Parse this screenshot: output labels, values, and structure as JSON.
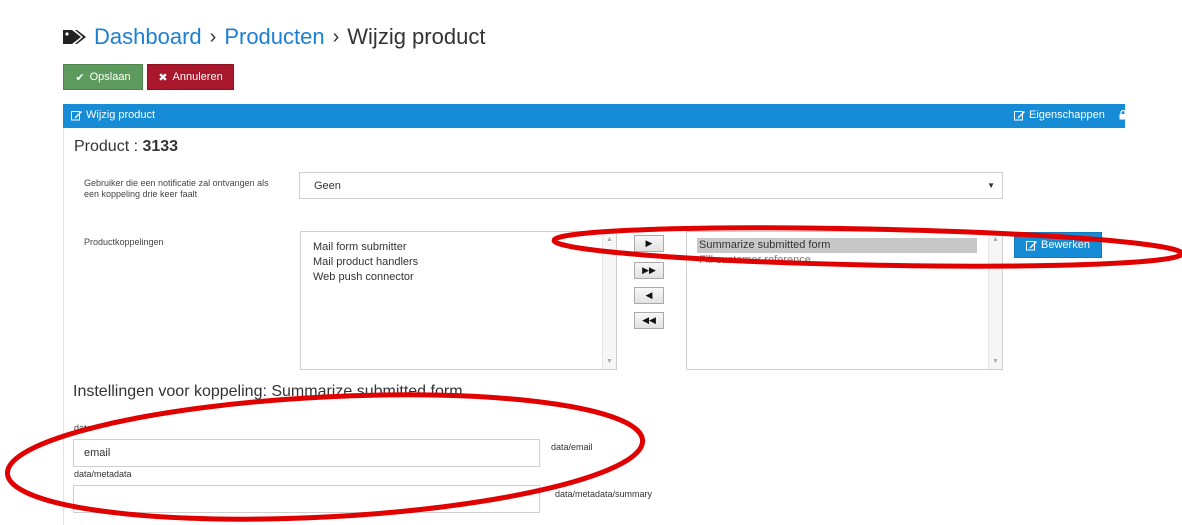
{
  "breadcrumb": {
    "items": [
      "Dashboard",
      "Producten"
    ],
    "separator": "›",
    "current": "Wijzig product"
  },
  "toolbar": {
    "save_label": "Opslaan",
    "cancel_label": "Annuleren"
  },
  "panel": {
    "title": "Wijzig product",
    "properties_label": "Eigenschappen"
  },
  "product": {
    "label": "Product :",
    "number": "3133"
  },
  "form": {
    "notify_label": "Gebruiker die een notificatie zal ontvangen als een koppeling drie keer faalt",
    "notify_value": "Geen",
    "links_label": "Productkoppelingen",
    "available_links": [
      "Mail form submitter",
      "Mail product handlers",
      "Web push connector"
    ],
    "selected_links": [
      "Summarize submitted form",
      "Fill customer reference"
    ],
    "move_buttons": [
      "▶",
      "▶▶",
      "◀",
      "◀◀"
    ],
    "edit_label": "Bewerken"
  },
  "settings": {
    "heading": "Instellingen voor koppeling: Summarize submitted form",
    "data_label": "data",
    "email_value": "email",
    "email_path": "data/email",
    "metadata_label": "data/metadata",
    "metadata_value": "",
    "metadata_path": "data/metadata/summary"
  },
  "colors": {
    "link": "#1b7fd4",
    "save": "#5d9a5d",
    "cancel": "#a8172b",
    "panel": "#168bd6",
    "annotation": "#e00000"
  }
}
